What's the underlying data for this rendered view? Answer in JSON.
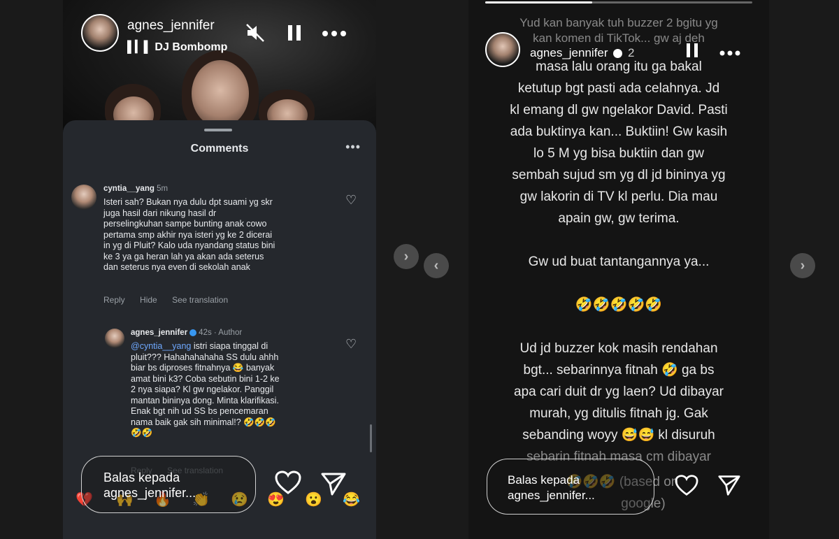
{
  "left_story": {
    "username": "agnes_jennifer",
    "music": "DJ Bombomp",
    "comments_sheet": {
      "title": "Comments",
      "more": "•••",
      "comment1": {
        "username": "cyntia__yang",
        "time": "5m",
        "lines": [
          "Isteri sah? Bukan nya dulu dpt suami yg skr",
          "juga hasil dari nikung hasil dr",
          "perselingkuhan sampe bunting anak cowo",
          "pertama smp akhir nya isteri yg ke 2 dicerai",
          "in yg di Pluit? Kalo uda nyandang status bini",
          "ke 3 ya ga heran lah ya akan ada seterus",
          "dan seterus nya even di sekolah anak"
        ],
        "actions": [
          "Reply",
          "Hide",
          "See translation"
        ]
      },
      "reply1": {
        "username": "agnes_jennifer",
        "meta": "42s · Author",
        "mention": "@cyntia__yang",
        "first_line_rest": " istri siapa tinggal di",
        "lines": [
          "pluit??? Hahahahahaha SS dulu ahhh",
          "biar bs diproses fitnahnya 😂 banyak",
          "amat bini k3? Coba sebutin bini 1-2 ke",
          "2 nya siapa? Kl gw ngelakor. Panggil",
          "mantan bininya dong. Minta klarifikasi.",
          "Enak bgt nih ud SS bs pencemaran",
          "nama baik gak sih minimal!? 🤣🤣🤣",
          "🤣🤣"
        ],
        "actions": [
          "Reply",
          "See translation"
        ]
      }
    },
    "reply_placeholder": [
      "Balas kepada",
      "agnes_jennifer..."
    ],
    "emojis": [
      "💔",
      "🙌",
      "🔥",
      "👏",
      "😢",
      "😍",
      "😮",
      "😂"
    ]
  },
  "right_story": {
    "username": "agnes_jennifer",
    "time": "2",
    "overlay_lines": [
      "Yud kan banyak tuh buzzer 2 bgitu yg",
      "kan komen di TikTok... gw aj deh"
    ],
    "paragraphs": [
      [
        "masa lalu orang itu ga bakal",
        "ketutup bgt pasti ada celahnya. Jd",
        "kl emang dl gw ngelakor David. Pasti",
        "ada buktinya kan... Buktiin! Gw kasih",
        "lo 5 M yg bisa buktiin dan gw",
        "sembah sujud sm yg dl jd bininya yg",
        "gw lakorin di TV kl perlu. Dia mau",
        "apain gw, gw terima."
      ],
      [
        "Gw ud buat tantangannya ya..."
      ],
      [
        "🤣🤣🤣🤣🤣"
      ],
      [
        "Ud jd buzzer kok masih rendahan",
        "bgt... sebarinnya fitnah 🤣 ga bs",
        "apa cari duit dr yg laen? Ud dibayar",
        "murah, yg ditulis fitnah jg. Gak",
        "sebanding woyy 😅😅 kl disuruh",
        "sebarin fitnah masa cm dibayar"
      ]
    ],
    "tail_line": "🤣🤣🤣 (based on",
    "tail_line2": "google)",
    "reply_placeholder": [
      "Balas kepada",
      "agnes_jennifer..."
    ]
  },
  "colors": {
    "sheet_bg": "#25282d",
    "mention": "#6ea8fe",
    "verified": "#3897f0"
  },
  "icons": {
    "mute": "speaker-muted-icon",
    "pause": "pause-icon",
    "more": "more-horizontal-icon",
    "heart": "heart-outline-icon",
    "send": "paper-plane-icon",
    "nav_next": "chevron-right-icon",
    "nav_prev": "chevron-left-icon"
  }
}
